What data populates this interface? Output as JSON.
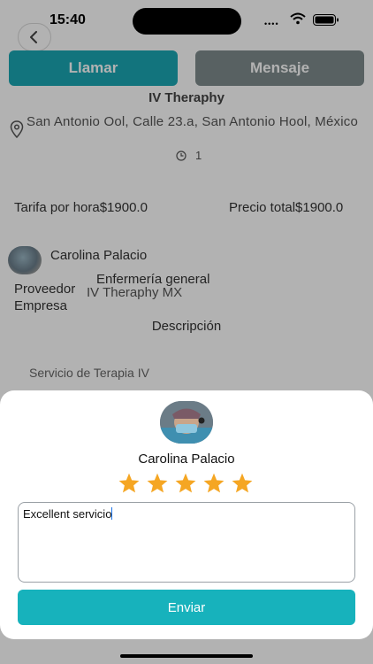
{
  "status_bar": {
    "time": "15:40",
    "signal": "••••"
  },
  "actions": {
    "call_label": "Llamar",
    "message_label": "Mensaje"
  },
  "service": {
    "title": "IV Theraphy",
    "address": "San Antonio Ool, Calle 23.a, San Antonio Hool, México",
    "duration": "1",
    "hourly_rate": "Tarifa por hora$1900.0",
    "total_price": "Precio total$1900.0"
  },
  "provider": {
    "name": "Carolina Palacio",
    "specialty": "Enfermería general",
    "provider_label": "Proveedor",
    "company_label": "Empresa",
    "company_name": "IV Theraphy MX"
  },
  "description": {
    "title": "Descripción",
    "text": "Servicio de Terapia IV"
  },
  "review": {
    "name": "Carolina Palacio",
    "rating": 5,
    "max_rating": 5,
    "text": "Excellent servicio",
    "submit_label": "Enviar",
    "star_color": "#f5a623"
  },
  "colors": {
    "primary": "#17b2bc",
    "secondary": "#7f8c8d"
  }
}
